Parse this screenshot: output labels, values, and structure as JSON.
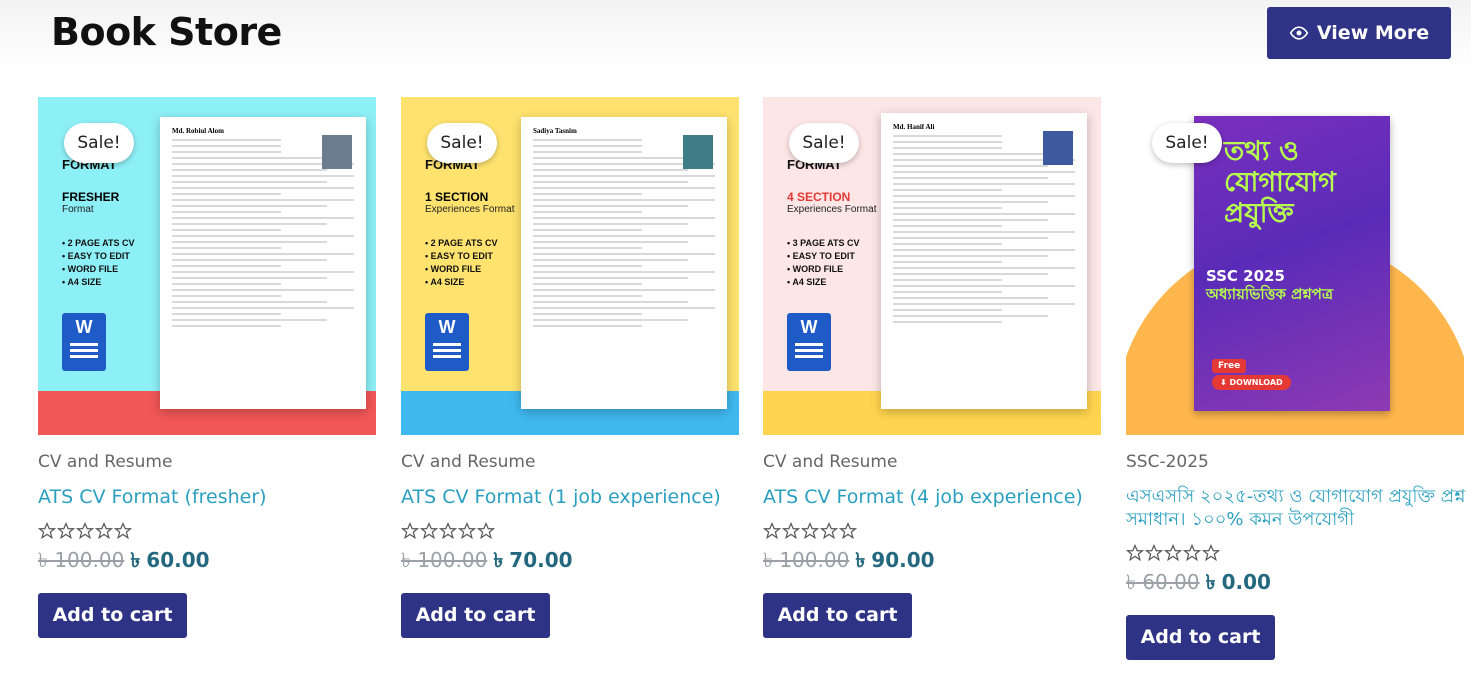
{
  "header": {
    "title": "Book Store",
    "view_more_label": "View More"
  },
  "sale_badge": "Sale!",
  "currency_symbol": "৳",
  "products": [
    {
      "category": "CV and Resume",
      "title": "ATS CV Format (fresher)",
      "old_price": "100.00",
      "price": "60.00",
      "rating": 0,
      "cart_label": "Add to cart",
      "thumb": {
        "format_label": "FORMAT",
        "type_label": "FRESHER",
        "type_sub": "Format",
        "features": [
          "• 2 PAGE ATS CV",
          "• EASY TO EDIT",
          "• WORD FILE",
          "• A4 SIZE"
        ],
        "cv_name": "Md. Robiul Alom",
        "word_letter": "W",
        "top_color": "#8ef0f7",
        "band_color": "#f25757",
        "type_color": "#111111"
      }
    },
    {
      "category": "CV and Resume",
      "title": "ATS CV Format (1 job experience)",
      "old_price": "100.00",
      "price": "70.00",
      "rating": 0,
      "cart_label": "Add to cart",
      "thumb": {
        "format_label": "FORMAT",
        "type_label": "1 SECTION",
        "type_sub": "Experiences Format",
        "features": [
          "• 2 PAGE ATS CV",
          "• EASY TO EDIT",
          "• WORD FILE",
          "• A4 SIZE"
        ],
        "cv_name": "Sadiya Tasnim",
        "word_letter": "W",
        "top_color": "#ffe36e",
        "band_color": "#3fb8f0",
        "type_color": "#111111"
      }
    },
    {
      "category": "CV and Resume",
      "title": "ATS CV Format (4 job experience)",
      "old_price": "100.00",
      "price": "90.00",
      "rating": 0,
      "cart_label": "Add to cart",
      "thumb": {
        "format_label": "FORMAT",
        "type_label": "4 SECTION",
        "type_sub": "Experiences Format",
        "features": [
          "• 3 PAGE ATS CV",
          "• EASY TO EDIT",
          "• WORD FILE",
          "• A4 SIZE"
        ],
        "cv_name": "Md. Hanif Ali",
        "word_letter": "W",
        "top_color": "#fde6e6",
        "band_color": "#ffd54f",
        "type_color": "#e53935"
      }
    },
    {
      "category": "SSC-2025",
      "title": "এসএসসি ২০২৫-তথ্য ও যোগাযোগ প্রযুক্তি প্রশ্ন সমাধান। ১০০% কমন উপযোগী",
      "old_price": "60.00",
      "price": "0.00",
      "rating": 0,
      "cart_label": "Add to cart",
      "thumb": {
        "book_title": "তথ্য ও যোগাযোগ প্রযুক্তি",
        "book_year": "SSC 2025",
        "book_sub": "অধ্যায়ভিত্তিক প্রশ্নপত্র",
        "free_label": "Free",
        "download_label": "DOWNLOAD"
      }
    }
  ],
  "colors": {
    "primary": "#2e3386",
    "link": "#2a9fbf",
    "price": "#23687e"
  }
}
